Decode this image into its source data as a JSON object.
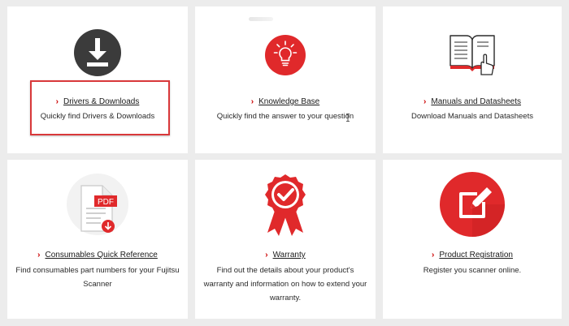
{
  "colors": {
    "page_background": "#ececec",
    "card_background": "#ffffff",
    "accent_red": "#e0292b",
    "dark_circle": "#3b3b3b",
    "chevron": "#cc0000",
    "highlight_border": "#d9383a"
  },
  "cards": [
    {
      "icon": "download-icon",
      "chevron": "›",
      "title": "Drivers & Downloads",
      "description": "Quickly find Drivers & Downloads",
      "highlighted": true
    },
    {
      "icon": "lightbulb-icon",
      "chevron": "›",
      "title": "Knowledge Base",
      "description": "Quickly find the answer to your question"
    },
    {
      "icon": "manual-book-icon",
      "chevron": "›",
      "title": "Manuals and Datasheets",
      "description": "Download Manuals and Datasheets"
    },
    {
      "icon": "pdf-document-icon",
      "icon_text": "PDF",
      "chevron": "›",
      "title": "Consumables Quick Reference",
      "description": "Find consumables part numbers for your Fujitsu Scanner"
    },
    {
      "icon": "warranty-badge-icon",
      "chevron": "›",
      "title": "Warranty",
      "description": "Find out the details about your product's warranty and information on how to extend your warranty."
    },
    {
      "icon": "product-registration-icon",
      "chevron": "›",
      "title": "Product Registration",
      "description": "Register you scanner online."
    }
  ]
}
